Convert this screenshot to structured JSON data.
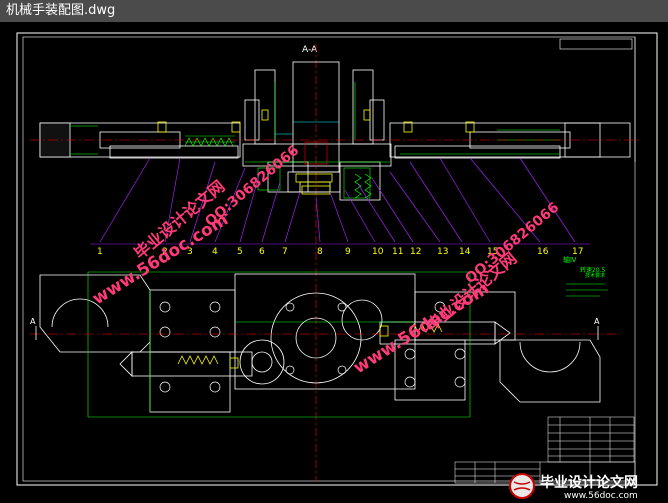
{
  "window": {
    "title": "机械手装配图.dwg"
  },
  "drawing": {
    "section_label": "A-A",
    "section_marks": [
      "A",
      "A"
    ],
    "balloons": [
      "1",
      "2",
      "3",
      "4",
      "5",
      "6",
      "7",
      "8",
      "9",
      "10",
      "11",
      "12",
      "13",
      "14",
      "15",
      "16",
      "17"
    ],
    "note_title": "技术要求",
    "side_label": "轴Ⅳ",
    "side_value": "转速20.5"
  },
  "watermarks": {
    "site": "www.56doc.com",
    "qq": "QQ:306826066",
    "name": "毕业设计论文网"
  },
  "logo": {
    "text": "毕业设计论文网",
    "url": "www.56doc.com"
  },
  "colors": {
    "background": "#000000",
    "frame": "#ffffff",
    "outline": "#ffffff",
    "leader": "#a020f0",
    "hatch": "#00ff00",
    "accent_yellow": "#ffff00",
    "accent_red": "#ff0000",
    "magenta": "#ff00ff",
    "cyan": "#00ffff",
    "watermark": "#ff3a78"
  }
}
